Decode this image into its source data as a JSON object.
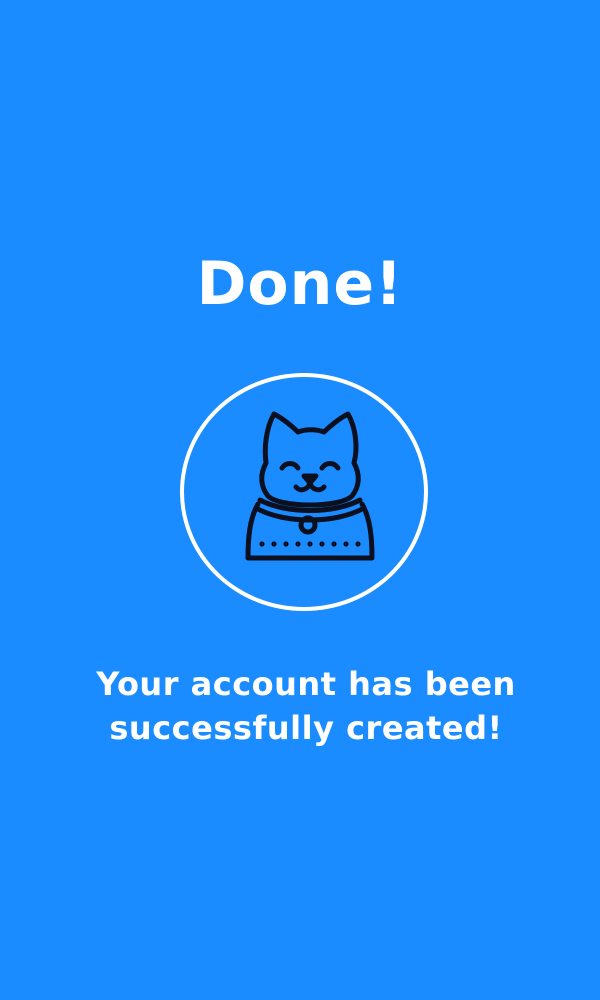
{
  "screen": {
    "title": "Done!",
    "message": "Your account has been successfully created!",
    "icon": "smiling-cat-icon"
  },
  "colors": {
    "background": "#1a8cff",
    "text": "#ffffff",
    "circle_border": "#ffffff",
    "icon_stroke": "#0a1020"
  }
}
